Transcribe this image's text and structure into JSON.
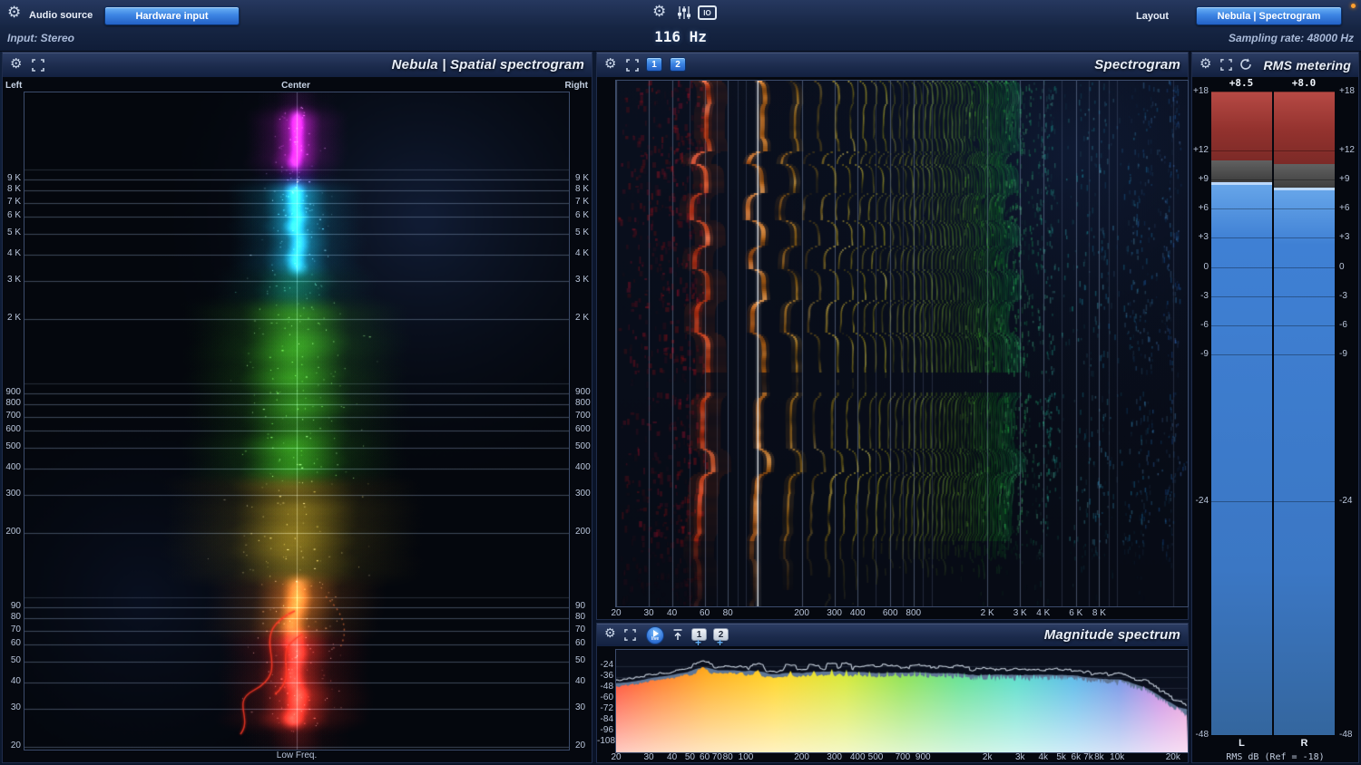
{
  "topbar": {
    "audio_source_label": "Audio source",
    "hardware_input_button": "Hardware input",
    "input_info": "Input: Stereo",
    "io_icon_label": "IO",
    "center_freq_readout": "116 Hz",
    "layout_button": "Layout",
    "preset_button": "Nebula | Spectrogram",
    "sampling_rate_info": "Sampling rate: 48000 Hz"
  },
  "spatial_panel": {
    "title": "Nebula | Spatial spectrogram",
    "top_axis": {
      "left": "Left",
      "center": "Center",
      "right": "Right"
    },
    "bottom_axis_label": "Low Freq.",
    "freq_labels": [
      "9 K",
      "8 K",
      "7 K",
      "6 K",
      "5 K",
      "4 K",
      "3 K",
      "2 K",
      "900",
      "800",
      "700",
      "600",
      "500",
      "400",
      "300",
      "200",
      "90",
      "80",
      "70",
      "60",
      "50",
      "40",
      "30",
      "20"
    ]
  },
  "spectrogram_panel": {
    "title": "Spectrogram",
    "layer_buttons": [
      "1",
      "2"
    ],
    "cursor_freq_hz": 116,
    "x_labels": [
      "20",
      "30",
      "40",
      "60",
      "80",
      "200",
      "300",
      "400",
      "600",
      "800",
      "2 K",
      "3 K",
      "4 K",
      "6 K",
      "8 K"
    ]
  },
  "magnitude_panel": {
    "title": "Magnitude spectrum",
    "live_button_label": "live",
    "add_button_label": "+",
    "layer_buttons": [
      "1",
      "2"
    ],
    "y_labels": [
      "-24",
      "-36",
      "-48",
      "-60",
      "-72",
      "-84",
      "-96",
      "-108"
    ],
    "x_labels": [
      "20",
      "30",
      "40",
      "50",
      "60",
      "70",
      "80",
      "100",
      "200",
      "300",
      "400",
      "500",
      "700",
      "900",
      "2k",
      "3k",
      "4k",
      "5k",
      "6k",
      "7k",
      "8k",
      "10k",
      "20k"
    ]
  },
  "rms_panel": {
    "title": "RMS metering",
    "left_value": "+8.5",
    "right_value": "+8.0",
    "scale_labels": [
      "+18",
      "+12",
      "+9",
      "+6",
      "+3",
      "0",
      "-3",
      "-6",
      "-9",
      "-24",
      "-48"
    ],
    "channel_labels": [
      "L",
      "R"
    ],
    "footer": "RMS dB (Ref = -18)",
    "meters": {
      "left": {
        "rms_db": 8.5,
        "peak_db": 10.9
      },
      "right": {
        "rms_db": 8.0,
        "peak_db": 10.6
      }
    }
  },
  "colors": {
    "accent_blue": "#3d85e4",
    "meter_blue": "#3f80d4",
    "meter_red": "#a03434",
    "record_dot": "#ffa030"
  }
}
